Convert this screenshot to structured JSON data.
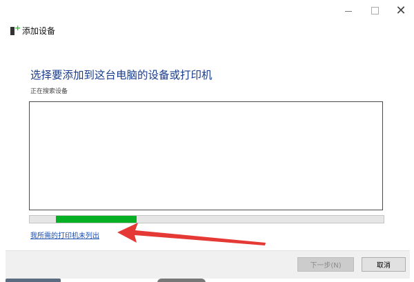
{
  "window": {
    "title": "添加设备",
    "controls": {
      "minimize_icon": "minimize-icon",
      "maximize_icon": "maximize-icon",
      "close_glyph": "✕"
    }
  },
  "main": {
    "heading": "选择要添加到这台电脑的设备或打印机",
    "status": "正在搜索设备",
    "progress_fraction": 0.23,
    "link_printer_not_listed": "我所需的打印机未列出"
  },
  "footer": {
    "next_label": "下一步(N)",
    "cancel_label": "取消"
  },
  "colors": {
    "heading": "#1a3c8c",
    "link": "#1a4fb0",
    "progress_fill": "#06b025",
    "annotation_arrow": "#e53935"
  }
}
